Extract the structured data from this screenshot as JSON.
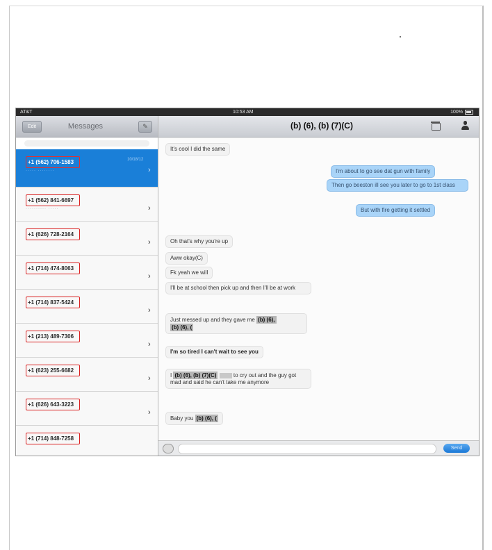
{
  "status_bar": {
    "carrier": "AT&T",
    "time": "10:53 AM",
    "battery": "100%"
  },
  "left_pane": {
    "edit_label": "Edit",
    "title": "Messages",
    "conversations": [
      {
        "name": "+1 (562) 706-1583",
        "date": "10/18/12",
        "preview": "····· ········",
        "selected": true
      },
      {
        "name": "+1 (562) 841-6697",
        "date": "",
        "preview": "·········· ·····",
        "selected": false
      },
      {
        "name": "+1 (626) 728-2164",
        "date": "",
        "preview": "",
        "selected": false
      },
      {
        "name": "+1 (714) 474-8063",
        "date": "",
        "preview": "",
        "selected": false
      },
      {
        "name": "+1 (714) 837-5424",
        "date": "",
        "preview": "",
        "selected": false
      },
      {
        "name": "+1 (213) 489-7306",
        "date": "",
        "preview": "",
        "selected": false
      },
      {
        "name": "+1 (623) 255-6682",
        "date": "",
        "preview": "",
        "selected": false
      },
      {
        "name": "+1 (626) 643-3223",
        "date": "",
        "preview": "",
        "selected": false
      },
      {
        "name": "+1 (714) 848-7258",
        "date": "",
        "preview": "",
        "selected": false
      }
    ]
  },
  "chat": {
    "title": "(b) (6), (b) (7)(C)",
    "messages": [
      {
        "text": "It's cool I did the same",
        "dir": "in"
      },
      {
        "text": "I'm about to go see dat gun with family",
        "dir": "out"
      },
      {
        "text": "Then go beeston ill see you later to go to 1st class",
        "dir": "out"
      },
      {
        "text": "But with fire getting it settled",
        "dir": "out"
      },
      {
        "text": "Oh that's why you're up",
        "dir": "in"
      },
      {
        "text": "Aww okay(C)",
        "dir": "in"
      },
      {
        "text": "Fk yeah we will",
        "dir": "in"
      },
      {
        "text": "I'll be at school then pick up and then I'll be at work",
        "dir": "in"
      },
      {
        "text": "Just messed up and they gave me",
        "dir": "in",
        "redaction": "(b) (6),",
        "redaction2": "(b) (6), ("
      },
      {
        "text": "I'm so tired I can't wait to see you",
        "dir": "in"
      },
      {
        "prefix": "I",
        "redaction": "(b) (6), (b) (7)(C)",
        "text": "to cry out and the guy got mad and said he can't take me anymore",
        "dir": "in"
      },
      {
        "text": "Baby you",
        "dir": "in",
        "redaction": "(b) (6), ("
      }
    ],
    "send_label": "Send"
  }
}
